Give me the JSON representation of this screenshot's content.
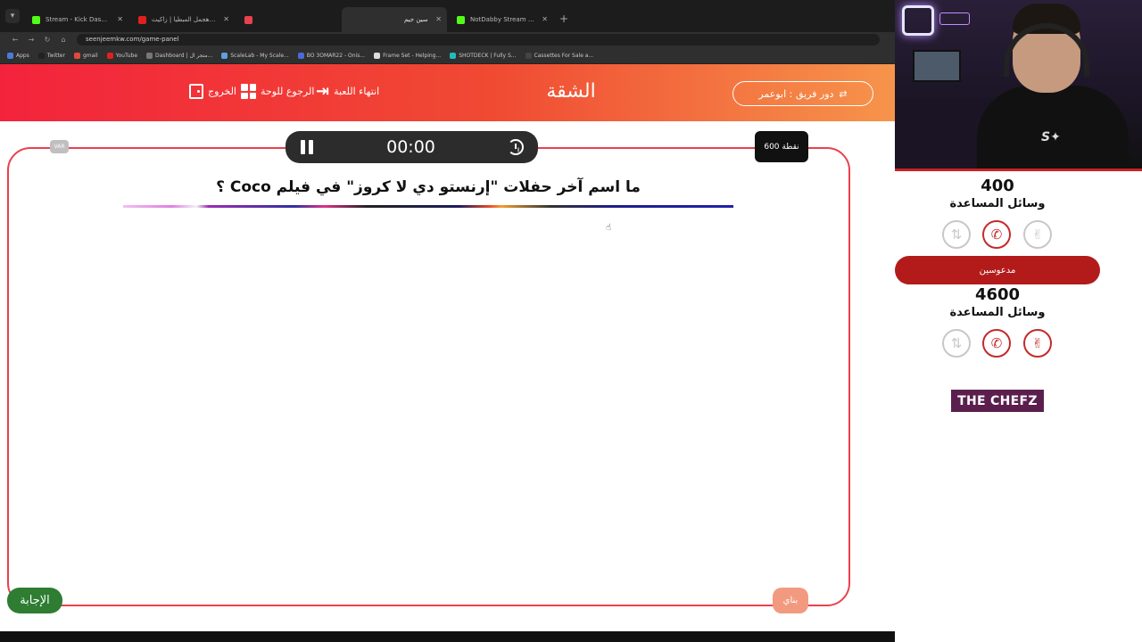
{
  "browser": {
    "tabs": [
      {
        "title": "Stream - Kick Dashboard",
        "color": "#53fc18",
        "active": false
      },
      {
        "title": "مهرجان هجمل المبطيا | زاكيت",
        "color": "#e02020",
        "active": false
      },
      {
        "title": "",
        "color": "#e8424d",
        "active": false
      },
      {
        "title": "سين جيم",
        "color": "",
        "active": true
      },
      {
        "title": "NotDabby Stream - Watch Live",
        "color": "#53fc18",
        "active": false
      }
    ],
    "url": "seenjeemkw.com/game-panel",
    "bookmarks": [
      {
        "label": "Apps",
        "color": "#4a7bd8"
      },
      {
        "label": "Twitter",
        "color": "#222"
      },
      {
        "label": "gmail",
        "color": "#e04a3a"
      },
      {
        "label": "YouTube",
        "color": "#e02020"
      },
      {
        "label": "Dashboard | متجر ال...",
        "color": "#777"
      },
      {
        "label": "ScaleLab - My Scale...",
        "color": "#5ea0e0"
      },
      {
        "label": "BO 3OMAR22 - Onis...",
        "color": "#4a6ad8"
      },
      {
        "label": "Frame Set - Helping...",
        "color": "#ddd"
      },
      {
        "label": "SHOTDECK | Fully S...",
        "color": "#2bb"
      },
      {
        "label": "Cassettes For Sale a...",
        "color": "#444"
      }
    ]
  },
  "header": {
    "exit_label": "الخروج",
    "back_label": "الرجوع للوحة",
    "end_label": "انتهاء اللعبة",
    "title": "الشقة",
    "turn_label": "دور فريق : ابوعمر"
  },
  "timer": {
    "time": "00:00"
  },
  "badges": {
    "small": "VAR",
    "points": "600 نقطة"
  },
  "question": {
    "text": "ما اسم آخر حفلات \"إرنستو دي لا كروز\" في فيلم Coco ؟"
  },
  "buttons": {
    "answer": "الإجابة",
    "build": "بناي"
  },
  "teams": [
    {
      "name": "",
      "score": "400",
      "aids_label": "وسائل المساعدة"
    },
    {
      "name": "مدعوسين",
      "score": "4600",
      "aids_label": "وسائل المساعدة"
    }
  ],
  "sponsor": {
    "label": "THE CHEFZ"
  },
  "colors": {
    "header_start": "#f3233c",
    "header_end": "#f6944b",
    "team_bar": "#b31b1b",
    "answer_green": "#2e7d32",
    "board_border": "#e8424d"
  }
}
